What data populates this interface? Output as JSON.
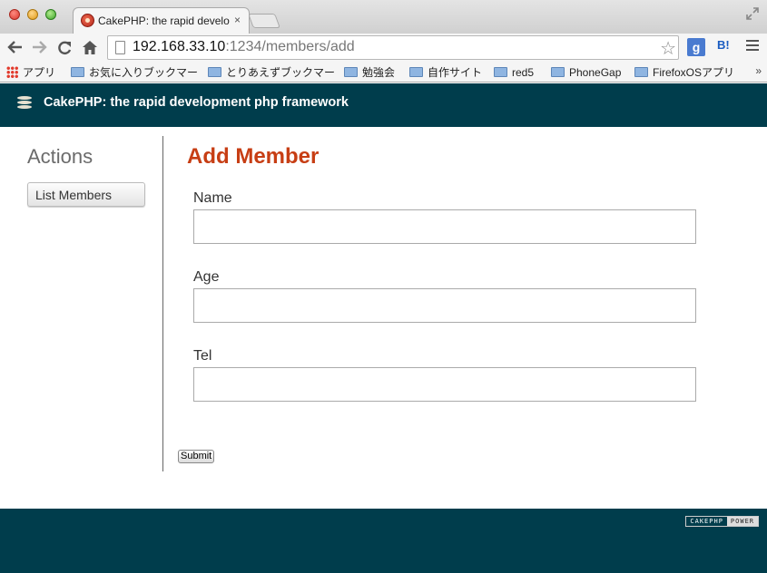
{
  "browser": {
    "tab_title": "CakePHP: the rapid develop",
    "tab_close": "×",
    "url_host": "192.168.33.10",
    "url_rest": ":1234/members/add",
    "star": "☆",
    "ext_g": "g",
    "ext_b": "B!",
    "bookmarks": [
      {
        "label": "アプリ",
        "icon": "apps-grid-icon"
      },
      {
        "label": "お気に入りブックマー",
        "icon": "folder-icon"
      },
      {
        "label": "とりあえずブックマー",
        "icon": "folder-icon"
      },
      {
        "label": "勉強会",
        "icon": "folder-icon"
      },
      {
        "label": "自作サイト",
        "icon": "folder-icon"
      },
      {
        "label": "red5",
        "icon": "folder-icon"
      },
      {
        "label": "PhoneGap",
        "icon": "folder-icon"
      },
      {
        "label": "FirefoxOSアプリ",
        "icon": "folder-icon"
      }
    ],
    "bookmarks_more": "»"
  },
  "header": {
    "title": "CakePHP: the rapid development php framework"
  },
  "sidebar": {
    "title": "Actions",
    "items": [
      {
        "label": "List Members"
      }
    ]
  },
  "form": {
    "title": "Add Member",
    "fields": [
      {
        "label": "Name",
        "value": ""
      },
      {
        "label": "Age",
        "value": ""
      },
      {
        "label": "Tel",
        "value": ""
      }
    ],
    "submit_label": "Submit"
  },
  "footer": {
    "badge_left": "CAKEPHP",
    "badge_right": "POWER"
  },
  "colors": {
    "header_bg": "#003d4c",
    "title_accent": "#c73e14"
  }
}
